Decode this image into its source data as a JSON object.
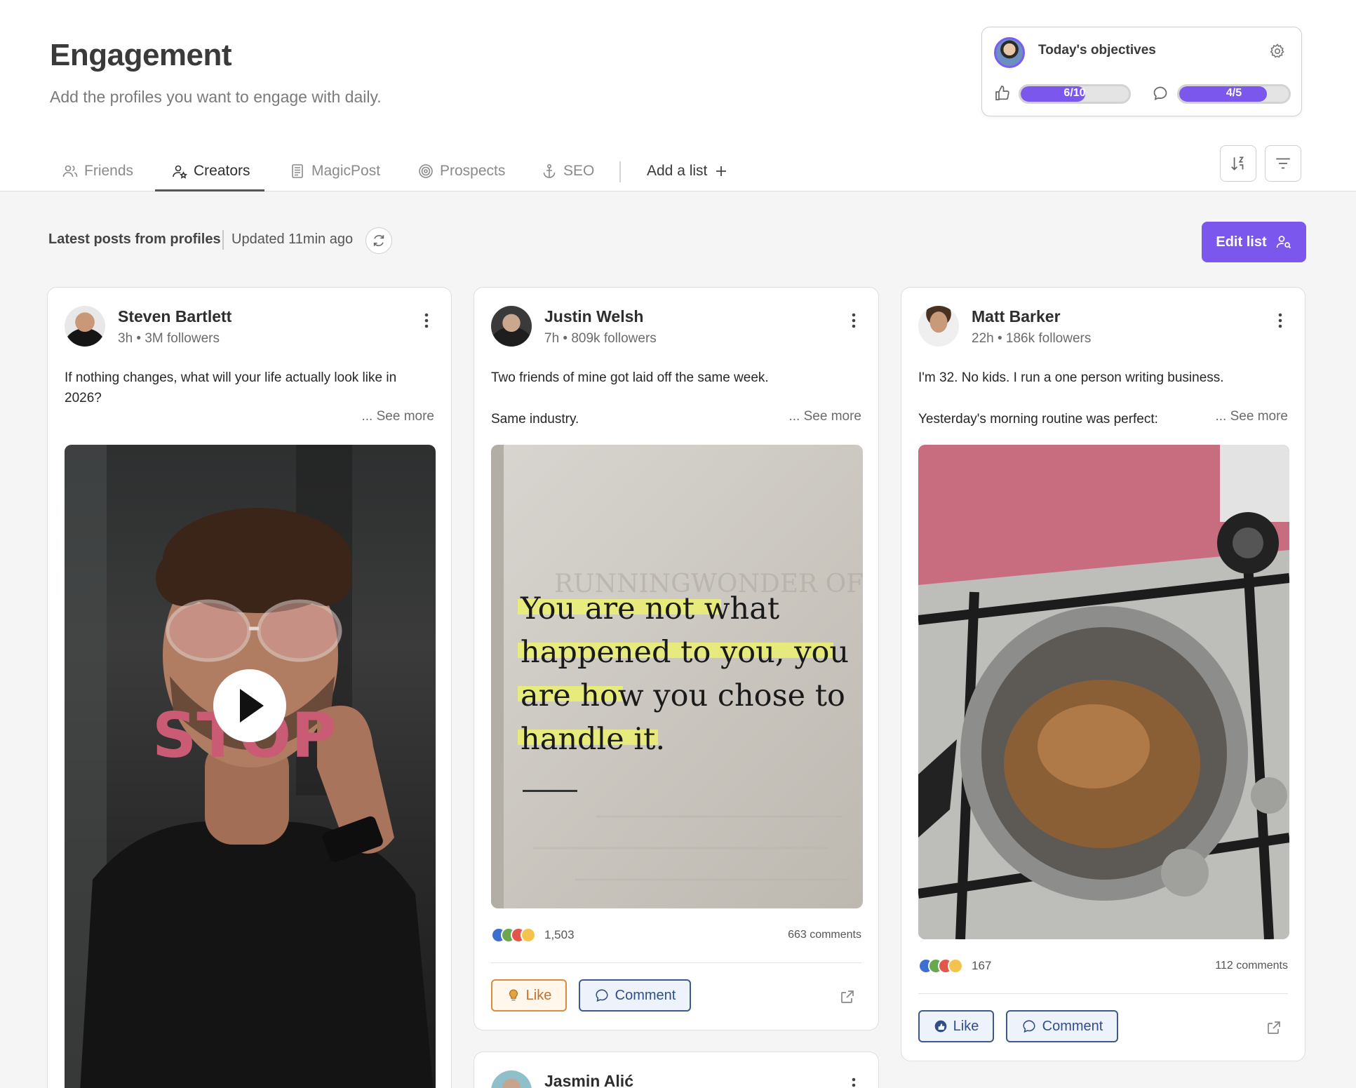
{
  "header": {
    "title": "Engagement",
    "subtitle": "Add the profiles you want to engage with daily."
  },
  "objectives": {
    "title": "Today's objectives",
    "likes": {
      "label": "6/10",
      "progress": 0.6
    },
    "comments": {
      "label": "4/5",
      "progress": 0.8
    }
  },
  "tabs": [
    {
      "label": "Friends",
      "icon": "users-icon"
    },
    {
      "label": "Creators",
      "icon": "creator-icon",
      "active": true
    },
    {
      "label": "MagicPost",
      "icon": "document-icon"
    },
    {
      "label": "Prospects",
      "icon": "target-icon"
    },
    {
      "label": "SEO",
      "icon": "anchor-icon"
    }
  ],
  "add_list_label": "Add a list",
  "feed": {
    "latest_label": "Latest posts from profiles",
    "updated_label": "Updated 11min ago",
    "edit_list_label": "Edit list"
  },
  "posts": [
    {
      "author": "Steven Bartlett",
      "meta": "3h • 3M followers",
      "text": "If nothing changes, what will your life actually look like in 2026?",
      "see_more": "... See more",
      "overlay_text": "STOP"
    },
    {
      "author": "Justin Welsh",
      "meta": "7h • 809k followers",
      "text_line1": "Two friends of mine got laid off the same week.",
      "text_line2": "Same industry.",
      "see_more": "... See more",
      "quote": [
        "You are not what",
        "happened to you, you",
        "are how you chose to",
        "handle it."
      ],
      "reaction_count": "1,503",
      "comments": "663 comments",
      "like_label": "Like",
      "comment_label": "Comment"
    },
    {
      "author": "Matt Barker",
      "meta": "22h • 186k followers",
      "text_line1": "I'm 32. No kids. I run a one person writing business.",
      "text_line2": "Yesterday's morning routine was perfect:",
      "see_more": "... See more",
      "reaction_count": "167",
      "comments": "112 comments",
      "like_label": "Like",
      "comment_label": "Comment"
    },
    {
      "author": "Jasmin Alić"
    }
  ],
  "colors": {
    "accent": "#7b57ee",
    "like_orange": "#d98c3c",
    "button_blue": "#3d5a8a"
  }
}
